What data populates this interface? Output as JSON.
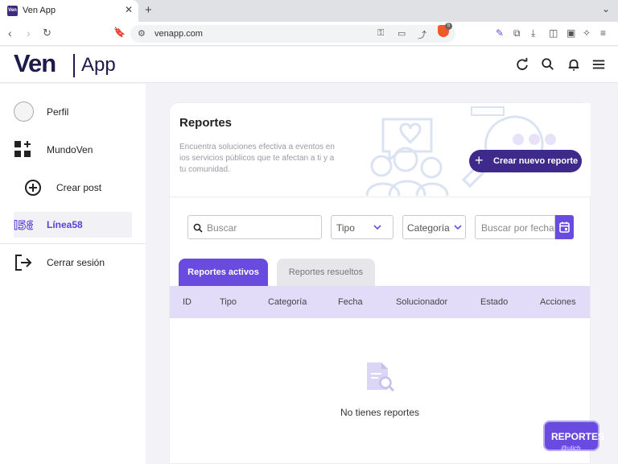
{
  "browser": {
    "tab_title": "Ven App",
    "tab_favicon": "Ven",
    "url": "venapp.com",
    "brave_badge": "5"
  },
  "header": {
    "logo_main": "Ven",
    "logo_sub": "App"
  },
  "sidebar": {
    "items": [
      {
        "label": "Perfil"
      },
      {
        "label": "MundoVen"
      },
      {
        "label": "Crear post"
      },
      {
        "label": "Línea58"
      },
      {
        "label": "Cerrar sesión"
      }
    ]
  },
  "main": {
    "title": "Reportes",
    "description": "Encuentra soluciones efectiva a eventos en ios servicios públicos que te afectan a ti y a tu comunidad.",
    "create_button": "Crear nuevo reporte",
    "filters": {
      "search_placeholder": "Buscar",
      "tipo": "Tipo",
      "categoria": "Categoría",
      "date_placeholder": "Buscar por fecha"
    },
    "tabs": [
      {
        "label": "Reportes activos",
        "active": true
      },
      {
        "label": "Reportes resueltos",
        "active": false
      }
    ],
    "columns": [
      "ID",
      "Tipo",
      "Categoría",
      "Fecha",
      "Solucionador",
      "Estado",
      "Acciones"
    ],
    "empty_text": "No tienes reportes"
  },
  "floating": {
    "label": "REPORTES",
    "sub": "@ulich"
  },
  "colors": {
    "primary": "#6a4be0",
    "dark": "#1e1b4b",
    "header_row": "#e3dcf9"
  }
}
